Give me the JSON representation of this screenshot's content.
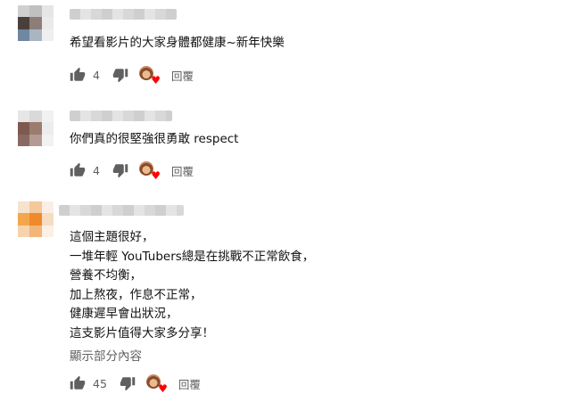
{
  "comments": [
    {
      "text_lines": [
        "希望看影片的大家身體都健康~新年快樂"
      ],
      "likes": "4",
      "reply_label": "回覆",
      "avatar_colors": [
        "#cfcfcf",
        "#c0c0c0",
        "#e6e6e6",
        "#4a3f3b",
        "#8c7e77",
        "#eaeaea",
        "#6f87a0",
        "#a8b5c3",
        "#efefef"
      ]
    },
    {
      "text_lines": [
        "你們真的很堅強很勇敢 respect"
      ],
      "likes": "4",
      "reply_label": "回覆",
      "avatar_colors": [
        "#e6e6e6",
        "#d9d9d9",
        "#f1f1f1",
        "#7d5a50",
        "#9c7b70",
        "#ececec",
        "#8a6a60",
        "#b49a92",
        "#f2f2f2"
      ]
    },
    {
      "text_lines": [
        "這個主題很好，",
        "一堆年輕 YouTubers總是在挑戰不正常飲食，",
        "營養不均衡，",
        "加上熬夜，作息不正常，",
        "健康遲早會出狀況，",
        "這支影片值得大家多分享！"
      ],
      "likes": "45",
      "reply_label": "回覆",
      "more_label": "顯示部分內容",
      "avatar_colors": [
        "#f5e3cf",
        "#f3c89a",
        "#f9efe4",
        "#f4a64d",
        "#ee8a2b",
        "#f6dcc2",
        "#f7d3ad",
        "#f2b57a",
        "#fbf0e4"
      ]
    }
  ],
  "icons": {
    "like": "thumbs-up-icon",
    "dislike": "thumbs-down-icon",
    "creator_heart": "creator-heart-icon"
  },
  "colors": {
    "icon": "#606060",
    "heart": "#ff0000",
    "muted_text": "#606060"
  }
}
